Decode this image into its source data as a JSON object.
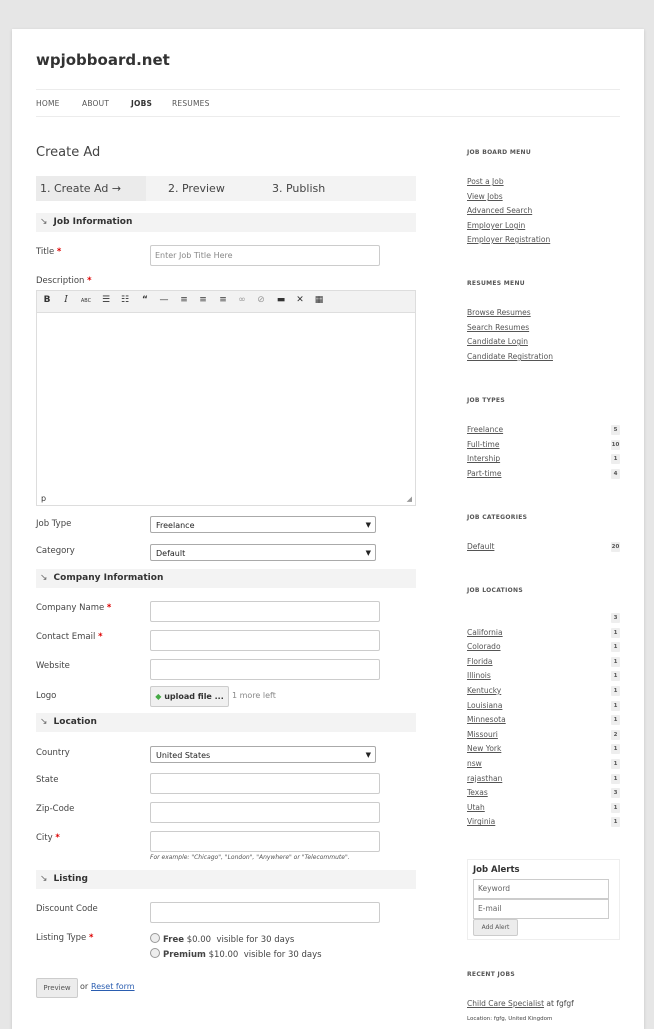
{
  "site": {
    "title": "wpjobboard.net"
  },
  "nav": {
    "items": [
      "HOME",
      "ABOUT",
      "JOBS",
      "RESUMES"
    ],
    "active": "JOBS"
  },
  "page_title": "Create Ad",
  "steps": [
    "1. Create Ad →",
    "2. Preview",
    "3. Publish"
  ],
  "sections": {
    "job_info": "Job Information",
    "company_info": "Company Information",
    "location": "Location",
    "listing": "Listing"
  },
  "form": {
    "title": {
      "label": "Title",
      "placeholder": "Enter Job Title Here"
    },
    "description": {
      "label": "Description",
      "footer": "p"
    },
    "job_type": {
      "label": "Job Type",
      "value": "Freelance"
    },
    "category": {
      "label": "Category",
      "value": "Default"
    },
    "company_name": {
      "label": "Company Name"
    },
    "contact_email": {
      "label": "Contact Email"
    },
    "website": {
      "label": "Website"
    },
    "logo": {
      "label": "Logo",
      "button": "upload file ...",
      "hint": "1 more left"
    },
    "country": {
      "label": "Country",
      "value": "United States"
    },
    "state": {
      "label": "State"
    },
    "zip": {
      "label": "Zip-Code"
    },
    "city": {
      "label": "City",
      "hint": "For example: \"Chicago\", \"London\", \"Anywhere\" or \"Telecommute\"."
    },
    "discount": {
      "label": "Discount Code"
    },
    "listing_type": {
      "label": "Listing Type",
      "options": [
        {
          "name": "Free",
          "price": "$0.00",
          "desc": "visible for 30 days"
        },
        {
          "name": "Premium",
          "price": "$10.00",
          "desc": "visible for 30 days"
        }
      ]
    },
    "required_mark": "*"
  },
  "actions": {
    "preview": "Preview",
    "or": "or",
    "reset": "Reset form"
  },
  "sidebar": {
    "job_board_menu": {
      "title": "JOB BOARD MENU",
      "items": [
        "Post a Job",
        "View Jobs",
        "Advanced Search",
        "Employer Login",
        "Employer Registration"
      ]
    },
    "resumes_menu": {
      "title": "RESUMES MENU",
      "items": [
        "Browse Resumes",
        "Search Resumes",
        "Candidate Login",
        "Candidate Registration"
      ]
    },
    "job_types": {
      "title": "JOB TYPES",
      "items": [
        {
          "label": "Freelance",
          "count": "5"
        },
        {
          "label": "Full-time",
          "count": "10"
        },
        {
          "label": "Intership",
          "count": "1"
        },
        {
          "label": "Part-time",
          "count": "4"
        }
      ]
    },
    "job_categories": {
      "title": "JOB CATEGORIES",
      "items": [
        {
          "label": "Default",
          "count": "20"
        }
      ]
    },
    "job_locations": {
      "title": "JOB LOCATIONS",
      "items": [
        {
          "label": "",
          "count": "3"
        },
        {
          "label": "California",
          "count": "1"
        },
        {
          "label": "Colorado",
          "count": "1"
        },
        {
          "label": "Florida",
          "count": "1"
        },
        {
          "label": "Illinois",
          "count": "1"
        },
        {
          "label": "Kentucky",
          "count": "1"
        },
        {
          "label": "Louisiana",
          "count": "1"
        },
        {
          "label": "Minnesota",
          "count": "1"
        },
        {
          "label": "Missouri",
          "count": "2"
        },
        {
          "label": "New York",
          "count": "1"
        },
        {
          "label": "nsw",
          "count": "1"
        },
        {
          "label": "rajasthan",
          "count": "1"
        },
        {
          "label": "Texas",
          "count": "3"
        },
        {
          "label": "Utah",
          "count": "1"
        },
        {
          "label": "Virginia",
          "count": "1"
        }
      ]
    },
    "job_alerts": {
      "title": "Job Alerts",
      "keyword_placeholder": "Keyword",
      "email_placeholder": "E-mail",
      "button": "Add Alert"
    },
    "recent_jobs": {
      "title": "RECENT JOBS",
      "items": [
        {
          "title": "Child Care Specialist",
          "at": "at",
          "company": "fgfgf",
          "location": "Location: fgfg, United Kingdom"
        }
      ]
    }
  }
}
